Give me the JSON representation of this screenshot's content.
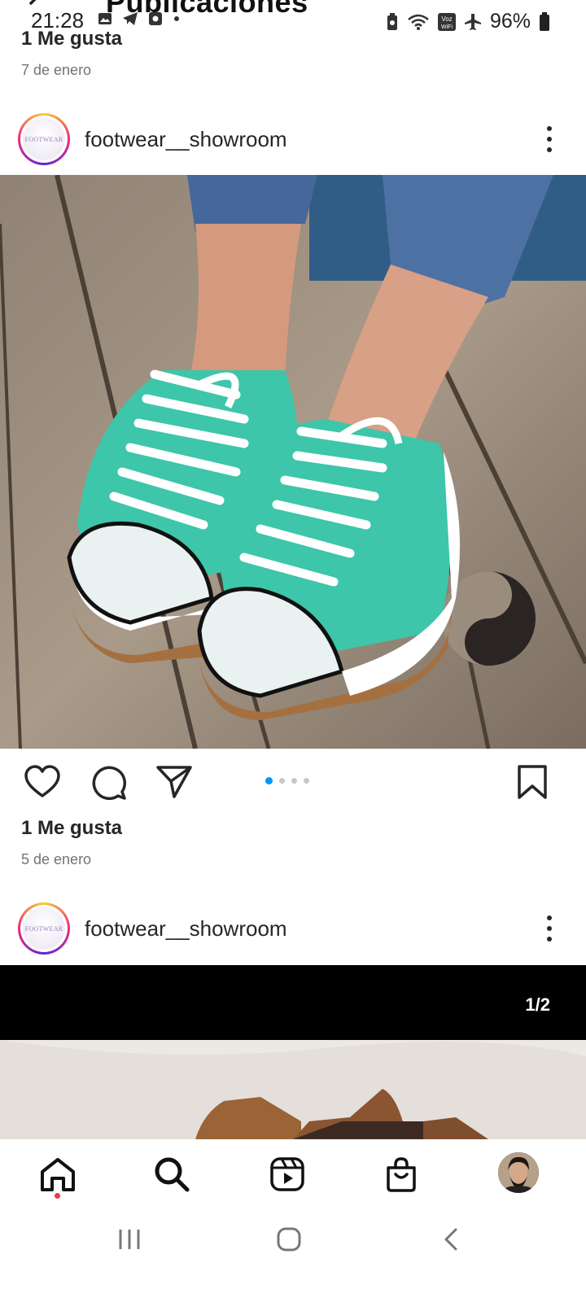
{
  "status_bar": {
    "time": "21:28",
    "battery": "96%",
    "volte_label": "Voz WiFi"
  },
  "top_cut": {
    "page_title": "Publicaciones",
    "likes": "1 Me gusta",
    "date": "7 de enero"
  },
  "post1": {
    "username": "footwear__showroom",
    "avatar_text": "FOOTWEAR",
    "likes": "1 Me gusta",
    "date": "5 de enero",
    "carousel_count": 4,
    "carousel_active": 1
  },
  "post2": {
    "username": "footwear__showroom",
    "avatar_text": "FOOTWEAR",
    "counter": "1/2"
  },
  "icons": {
    "like": "heart-icon",
    "comment": "comment-icon",
    "share": "paper-plane-icon",
    "save": "bookmark-icon",
    "more": "more-vertical-icon"
  },
  "bottom_nav": [
    "home-icon",
    "search-icon",
    "reels-icon",
    "shop-icon",
    "profile-avatar"
  ],
  "colors": {
    "accent_blue": "#0095f6",
    "notification_red": "#ff3040",
    "shoe_teal": "#3dc6a9"
  }
}
